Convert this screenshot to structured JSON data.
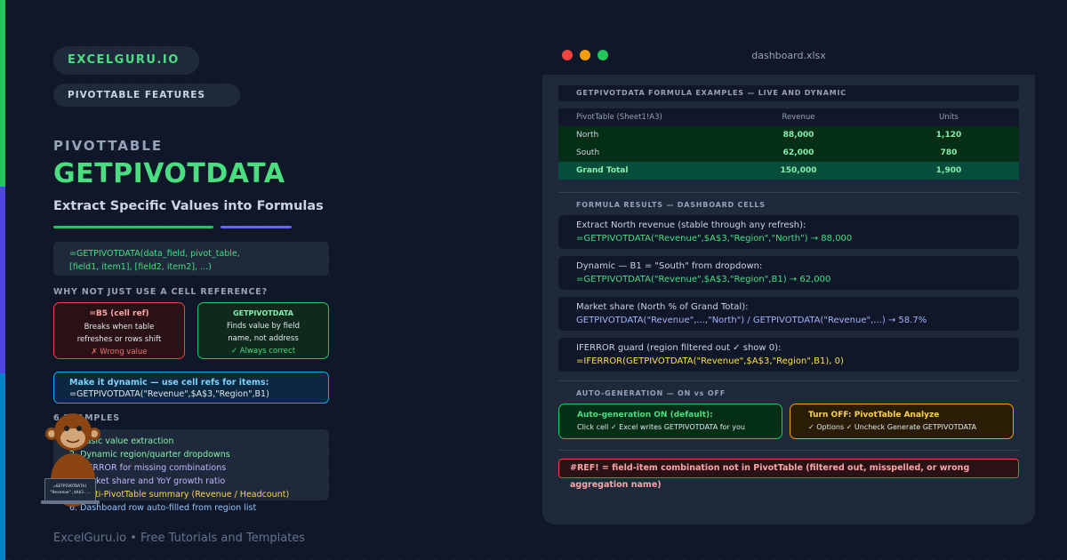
{
  "brand": {
    "pill": "EXCELGURU.IO",
    "feature_pill": "PIVOTTABLE FEATURES",
    "footer": "ExcelGuru.io • Free Tutorials and Templates"
  },
  "hero": {
    "eyebrow": "PIVOTTABLE",
    "title": "GETPIVOTDATA",
    "subtitle": "Extract Specific Values into Formulas"
  },
  "syntax": {
    "line1": "=GETPIVOTDATA(data_field, pivot_table,",
    "line2": "[field1, item1], [field2, item2], ...)"
  },
  "why": {
    "heading": "WHY NOT JUST USE A CELL REFERENCE?",
    "bad": {
      "title": "=B5 (cell ref)",
      "line1": "Breaks when table",
      "line2": "refreshes or rows shift",
      "status": "✗ Wrong value"
    },
    "good": {
      "title": "GETPIVOTDATA",
      "line1": "Finds value by field",
      "line2": "name, not address",
      "status": "✓ Always correct"
    }
  },
  "tip": {
    "title": "Make it dynamic — use cell refs for items:",
    "formula": "=GETPIVOTDATA(\"Revenue\",$A$3,\"Region\",B1)"
  },
  "examples": {
    "heading": "6 EXAMPLES",
    "items": [
      "1. Basic value extraction",
      "2. Dynamic region/quarter dropdowns",
      "3. IFERROR for missing combinations",
      "4. Market share and YoY growth ratio",
      "5. Multi-PivotTable summary (Revenue / Headcount)",
      "6. Dashboard row auto-filled from region list"
    ]
  },
  "mascot": {
    "laptop_line1": "=GETPIVOTDATA(",
    "laptop_line2": "\"Revenue\",$A$3..."
  },
  "window": {
    "title": "dashboard.xlsx",
    "section1": "GETPIVOTDATA FORMULA EXAMPLES — LIVE AND DYNAMIC",
    "pivot": {
      "headers": [
        "PivotTable (Sheet1!A3)",
        "Revenue",
        "Units"
      ],
      "rows": [
        [
          "North",
          "88,000",
          "1,120"
        ],
        [
          "South",
          "62,000",
          "780"
        ]
      ],
      "total": [
        "Grand Total",
        "150,000",
        "1,900"
      ]
    },
    "section2": "FORMULA RESULTS — DASHBOARD CELLS",
    "formulas": [
      {
        "label": "Extract North revenue (stable through any refresh):",
        "formula": "=GETPIVOTDATA(\"Revenue\",$A$3,\"Region\",\"North\") → 88,000"
      },
      {
        "label": "Dynamic — B1 = \"South\" from dropdown:",
        "formula": "=GETPIVOTDATA(\"Revenue\",$A$3,\"Region\",B1) → 62,000"
      },
      {
        "label": "Market share (North % of Grand Total):",
        "formula": "GETPIVOTDATA(\"Revenue\",...,\"North\") / GETPIVOTDATA(\"Revenue\",...) → 58.7%"
      },
      {
        "label": "IFERROR guard (region filtered out ✓ show 0):",
        "formula": "=IFERROR(GETPIVOTDATA(\"Revenue\",$A$3,\"Region\",B1), 0)"
      }
    ],
    "section3": "AUTO-GENERATION — ON vs OFF",
    "auto_on": {
      "title": "Auto-generation ON (default):",
      "text": "Click cell ✓ Excel writes GETPIVOTDATA for you"
    },
    "auto_off": {
      "title": "Turn OFF: PivotTable Analyze",
      "text": "✓ Options ✓ Uncheck Generate GETPIVOTDATA"
    },
    "error": "#REF! = field-item combination not in PivotTable (filtered out, misspelled, or wrong aggregation name)"
  },
  "colors": {
    "accent_green": "#4ade80",
    "accent_indigo": "#6366f1",
    "error_red": "#ef4444",
    "warning_amber": "#f59e0b",
    "info_blue": "#0ea5e9"
  }
}
